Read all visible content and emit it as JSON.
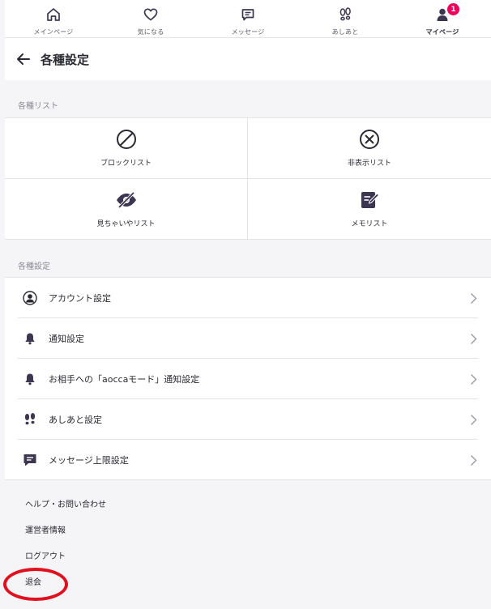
{
  "tabbar": {
    "tabs": [
      {
        "label": "メインページ",
        "icon": "home-icon"
      },
      {
        "label": "気になる",
        "icon": "heart-icon"
      },
      {
        "label": "メッセージ",
        "icon": "message-icon"
      },
      {
        "label": "あしあと",
        "icon": "footprints-icon"
      },
      {
        "label": "マイページ",
        "icon": "user-icon",
        "badge": "1",
        "active": true
      }
    ]
  },
  "header": {
    "title": "各種設定",
    "back_icon": "arrow-left-icon"
  },
  "lists": {
    "section_label": "各種リスト",
    "items": [
      {
        "label": "ブロックリスト",
        "icon": "block-icon"
      },
      {
        "label": "非表示リスト",
        "icon": "hide-icon"
      },
      {
        "label": "見ちゃいやリスト",
        "icon": "eye-off-icon"
      },
      {
        "label": "メモリスト",
        "icon": "memo-icon"
      }
    ]
  },
  "settings": {
    "section_label": "各種設定",
    "items": [
      {
        "label": "アカウント設定",
        "icon": "account-icon"
      },
      {
        "label": "通知設定",
        "icon": "bell-icon"
      },
      {
        "label": "お相手への「aoccaモード」通知設定",
        "icon": "bell-icon"
      },
      {
        "label": "あしあと設定",
        "icon": "footprints-icon"
      },
      {
        "label": "メッセージ上限設定",
        "icon": "message-icon"
      }
    ]
  },
  "footer": {
    "links": [
      "ヘルプ・お問い合わせ",
      "運営者情報",
      "ログアウト",
      "退会"
    ]
  },
  "colors": {
    "accent_badge": "#e8005a",
    "highlight": "#e0101e",
    "icon": "#3d3650"
  }
}
